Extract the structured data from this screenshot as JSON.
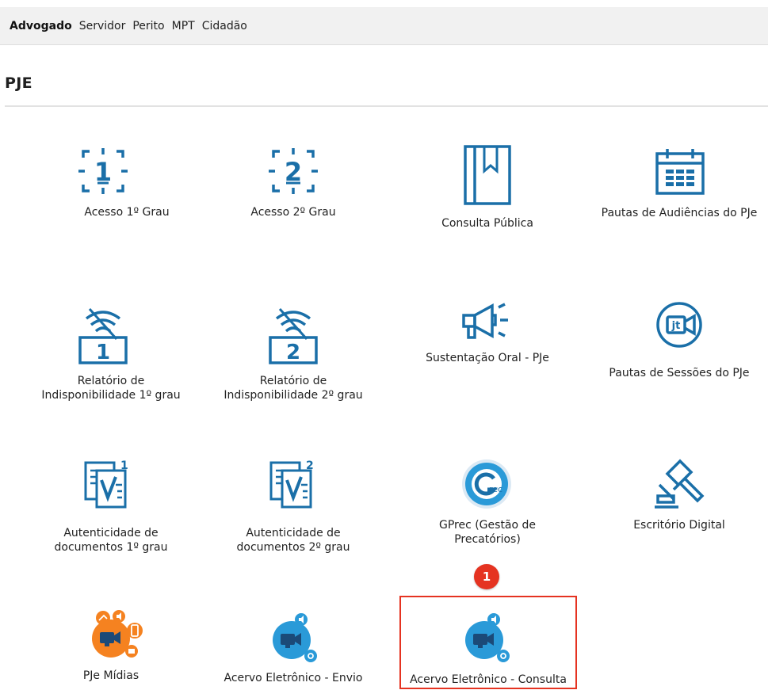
{
  "tabs": [
    "Advogado",
    "Servidor",
    "Perito",
    "MPT",
    "Cidadão"
  ],
  "active_tab": "Advogado",
  "section_title": "PJE",
  "tiles": {
    "acesso1": {
      "label": "Acesso 1º Grau",
      "icon": "grade-1-icon"
    },
    "acesso2": {
      "label": "Acesso 2º Grau",
      "icon": "grade-2-icon"
    },
    "consulta": {
      "label": "Consulta Pública",
      "icon": "book-icon"
    },
    "pautas_aud": {
      "label": "Pautas de Audiências do PJe",
      "icon": "calendar-icon"
    },
    "rel1": {
      "line1": "Relatório de",
      "line2": "Indisponibilidade 1º grau",
      "icon": "no-signal-1-icon"
    },
    "rel2": {
      "line1": "Relatório de",
      "line2": "Indisponibilidade 2º grau",
      "icon": "no-signal-2-icon"
    },
    "sust": {
      "label": "Sustentação Oral - PJe",
      "icon": "megaphone-icon"
    },
    "pautas_sess": {
      "label": "Pautas de Sessões do PJe",
      "icon": "video-session-icon"
    },
    "aut1": {
      "line1": "Autenticidade de",
      "line2": "documentos 1º grau",
      "icon": "document-check-1-icon"
    },
    "aut2": {
      "line1": "Autenticidade de",
      "line2": "documentos 2º grau",
      "icon": "document-check-2-icon"
    },
    "gprec": {
      "line1": "GPrec (Gestão de",
      "line2": "Precatórios)",
      "icon": "gprec-logo-icon",
      "logo_text": "rec"
    },
    "escritorio": {
      "label": "Escritório Digital",
      "icon": "gavel-icon"
    },
    "midias": {
      "label": "PJe Mídias",
      "icon": "media-orange-icon"
    },
    "acervo_envio": {
      "label": "Acervo Eletrônico - Envio",
      "icon": "media-blue-icon"
    },
    "acervo_consulta": {
      "label": "Acervo Eletrônico - Consulta",
      "icon": "media-blue-icon"
    }
  },
  "annotation": {
    "badge": "1"
  },
  "colors": {
    "accent": "#1a6fa8",
    "highlight": "#e53321",
    "orange": "#f58220",
    "blue": "#2a9ad8"
  }
}
